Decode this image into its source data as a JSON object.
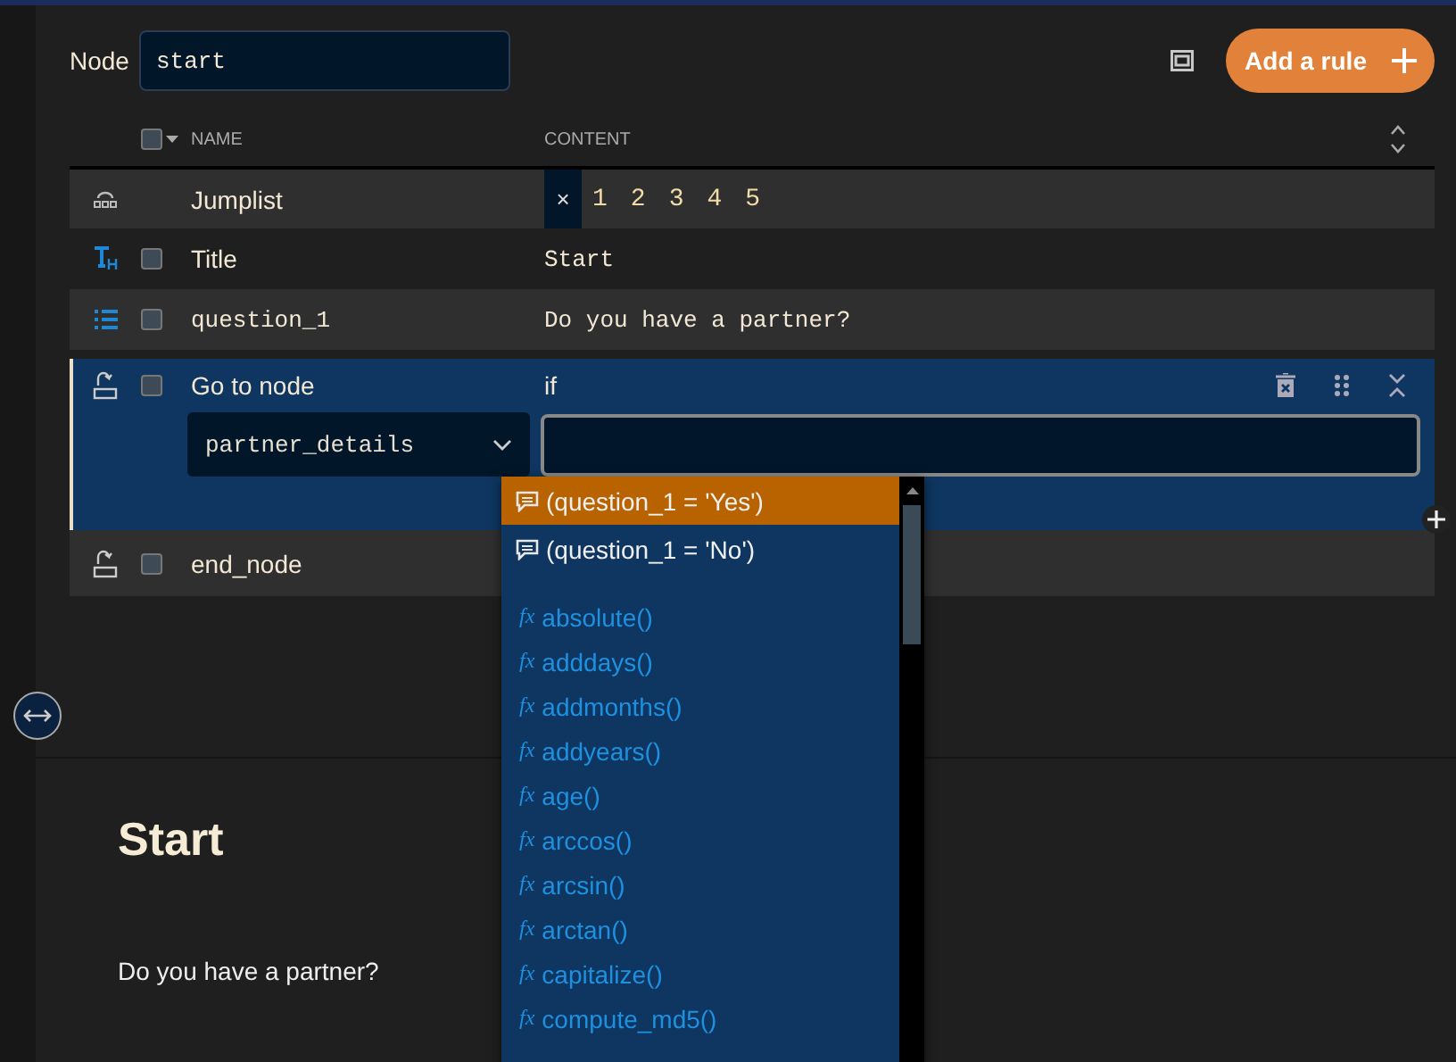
{
  "header": {
    "node_label": "Node",
    "node_value": "start",
    "add_button": "Add a rule"
  },
  "table": {
    "columns": [
      "NAME",
      "CONTENT"
    ],
    "select_all": {
      "checked": false
    },
    "rows": [
      {
        "kind": "jumplist",
        "name": "Jumplist",
        "clear": "×",
        "items": [
          "1",
          "2",
          "3",
          "4",
          "5"
        ]
      },
      {
        "kind": "title",
        "name": "Title",
        "content": "Start",
        "checked": false
      },
      {
        "kind": "question",
        "name": "question_1",
        "content": "Do you have a partner?",
        "checked": false
      },
      {
        "kind": "goto",
        "name": "Go to node",
        "condition_label": "if",
        "target": "partner_details",
        "expanded": true,
        "checked": false
      },
      {
        "kind": "goto",
        "name": "end_node",
        "expanded": false,
        "checked": false
      }
    ]
  },
  "suggestions": [
    {
      "kind": "condition",
      "text": "(question_1 = 'Yes')",
      "selected": true
    },
    {
      "kind": "condition",
      "text": "(question_1 = 'No')",
      "selected": false
    },
    {
      "kind": "function",
      "icon_text": "fx",
      "text": "absolute()",
      "selected": false
    },
    {
      "kind": "function",
      "icon_text": "fx",
      "text": "adddays()",
      "selected": false
    },
    {
      "kind": "function",
      "icon_text": "fx",
      "text": "addmonths()",
      "selected": false
    },
    {
      "kind": "function",
      "icon_text": "fx",
      "text": "addyears()",
      "selected": false
    },
    {
      "kind": "function",
      "icon_text": "fx",
      "text": "age()",
      "selected": false
    },
    {
      "kind": "function",
      "icon_text": "fx",
      "text": "arccos()",
      "selected": false
    },
    {
      "kind": "function",
      "icon_text": "fx",
      "text": "arcsin()",
      "selected": false
    },
    {
      "kind": "function",
      "icon_text": "fx",
      "text": "arctan()",
      "selected": false
    },
    {
      "kind": "function",
      "icon_text": "fx",
      "text": "capitalize()",
      "selected": false
    },
    {
      "kind": "function",
      "icon_text": "fx",
      "text": "compute_md5()",
      "selected": false
    }
  ],
  "preview": {
    "title": "Start",
    "text": "Do you have a partner?"
  }
}
